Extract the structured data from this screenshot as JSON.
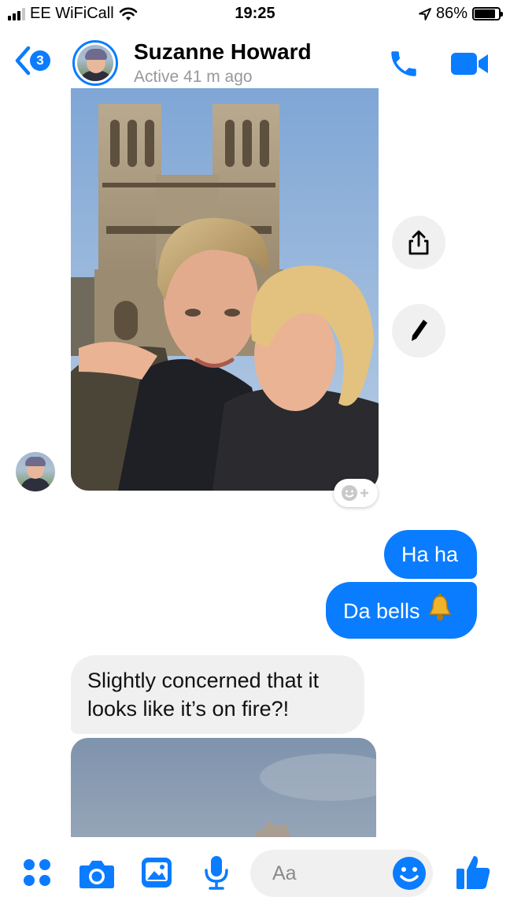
{
  "status_bar": {
    "carrier": "EE WiFiCall",
    "time": "19:25",
    "battery": "86%",
    "battery_level": 0.86
  },
  "header": {
    "back_badge_count": "3",
    "contact_name": "Suzanne Howard",
    "contact_status": "Active 41 m ago",
    "icons": [
      "back-chevron-icon",
      "phone-icon",
      "video-camera-icon"
    ]
  },
  "messages": [
    {
      "sender": "contact",
      "type": "photo",
      "description_icon": "photo-message"
    },
    {
      "sender": "me",
      "type": "text",
      "text": "Ha ha"
    },
    {
      "sender": "me",
      "type": "text",
      "text": "Da bells",
      "emoji": "🔔"
    },
    {
      "sender": "contact",
      "type": "text",
      "text_line1": "Slightly concerned that it",
      "text_line2": "looks like it’s on fire?!"
    },
    {
      "sender": "contact",
      "type": "photo"
    }
  ],
  "photo_actions": [
    "share-icon",
    "edit-pencil-icon"
  ],
  "composer": {
    "placeholder": "Aa",
    "icons": [
      "apps-grid-icon",
      "camera-icon",
      "gallery-icon",
      "microphone-icon",
      "emoji-icon",
      "thumbs-up-icon"
    ]
  },
  "colors": {
    "accent": "#0a7cff",
    "incoming_bubble": "#f0f0f0",
    "secondary_text": "#999999"
  }
}
